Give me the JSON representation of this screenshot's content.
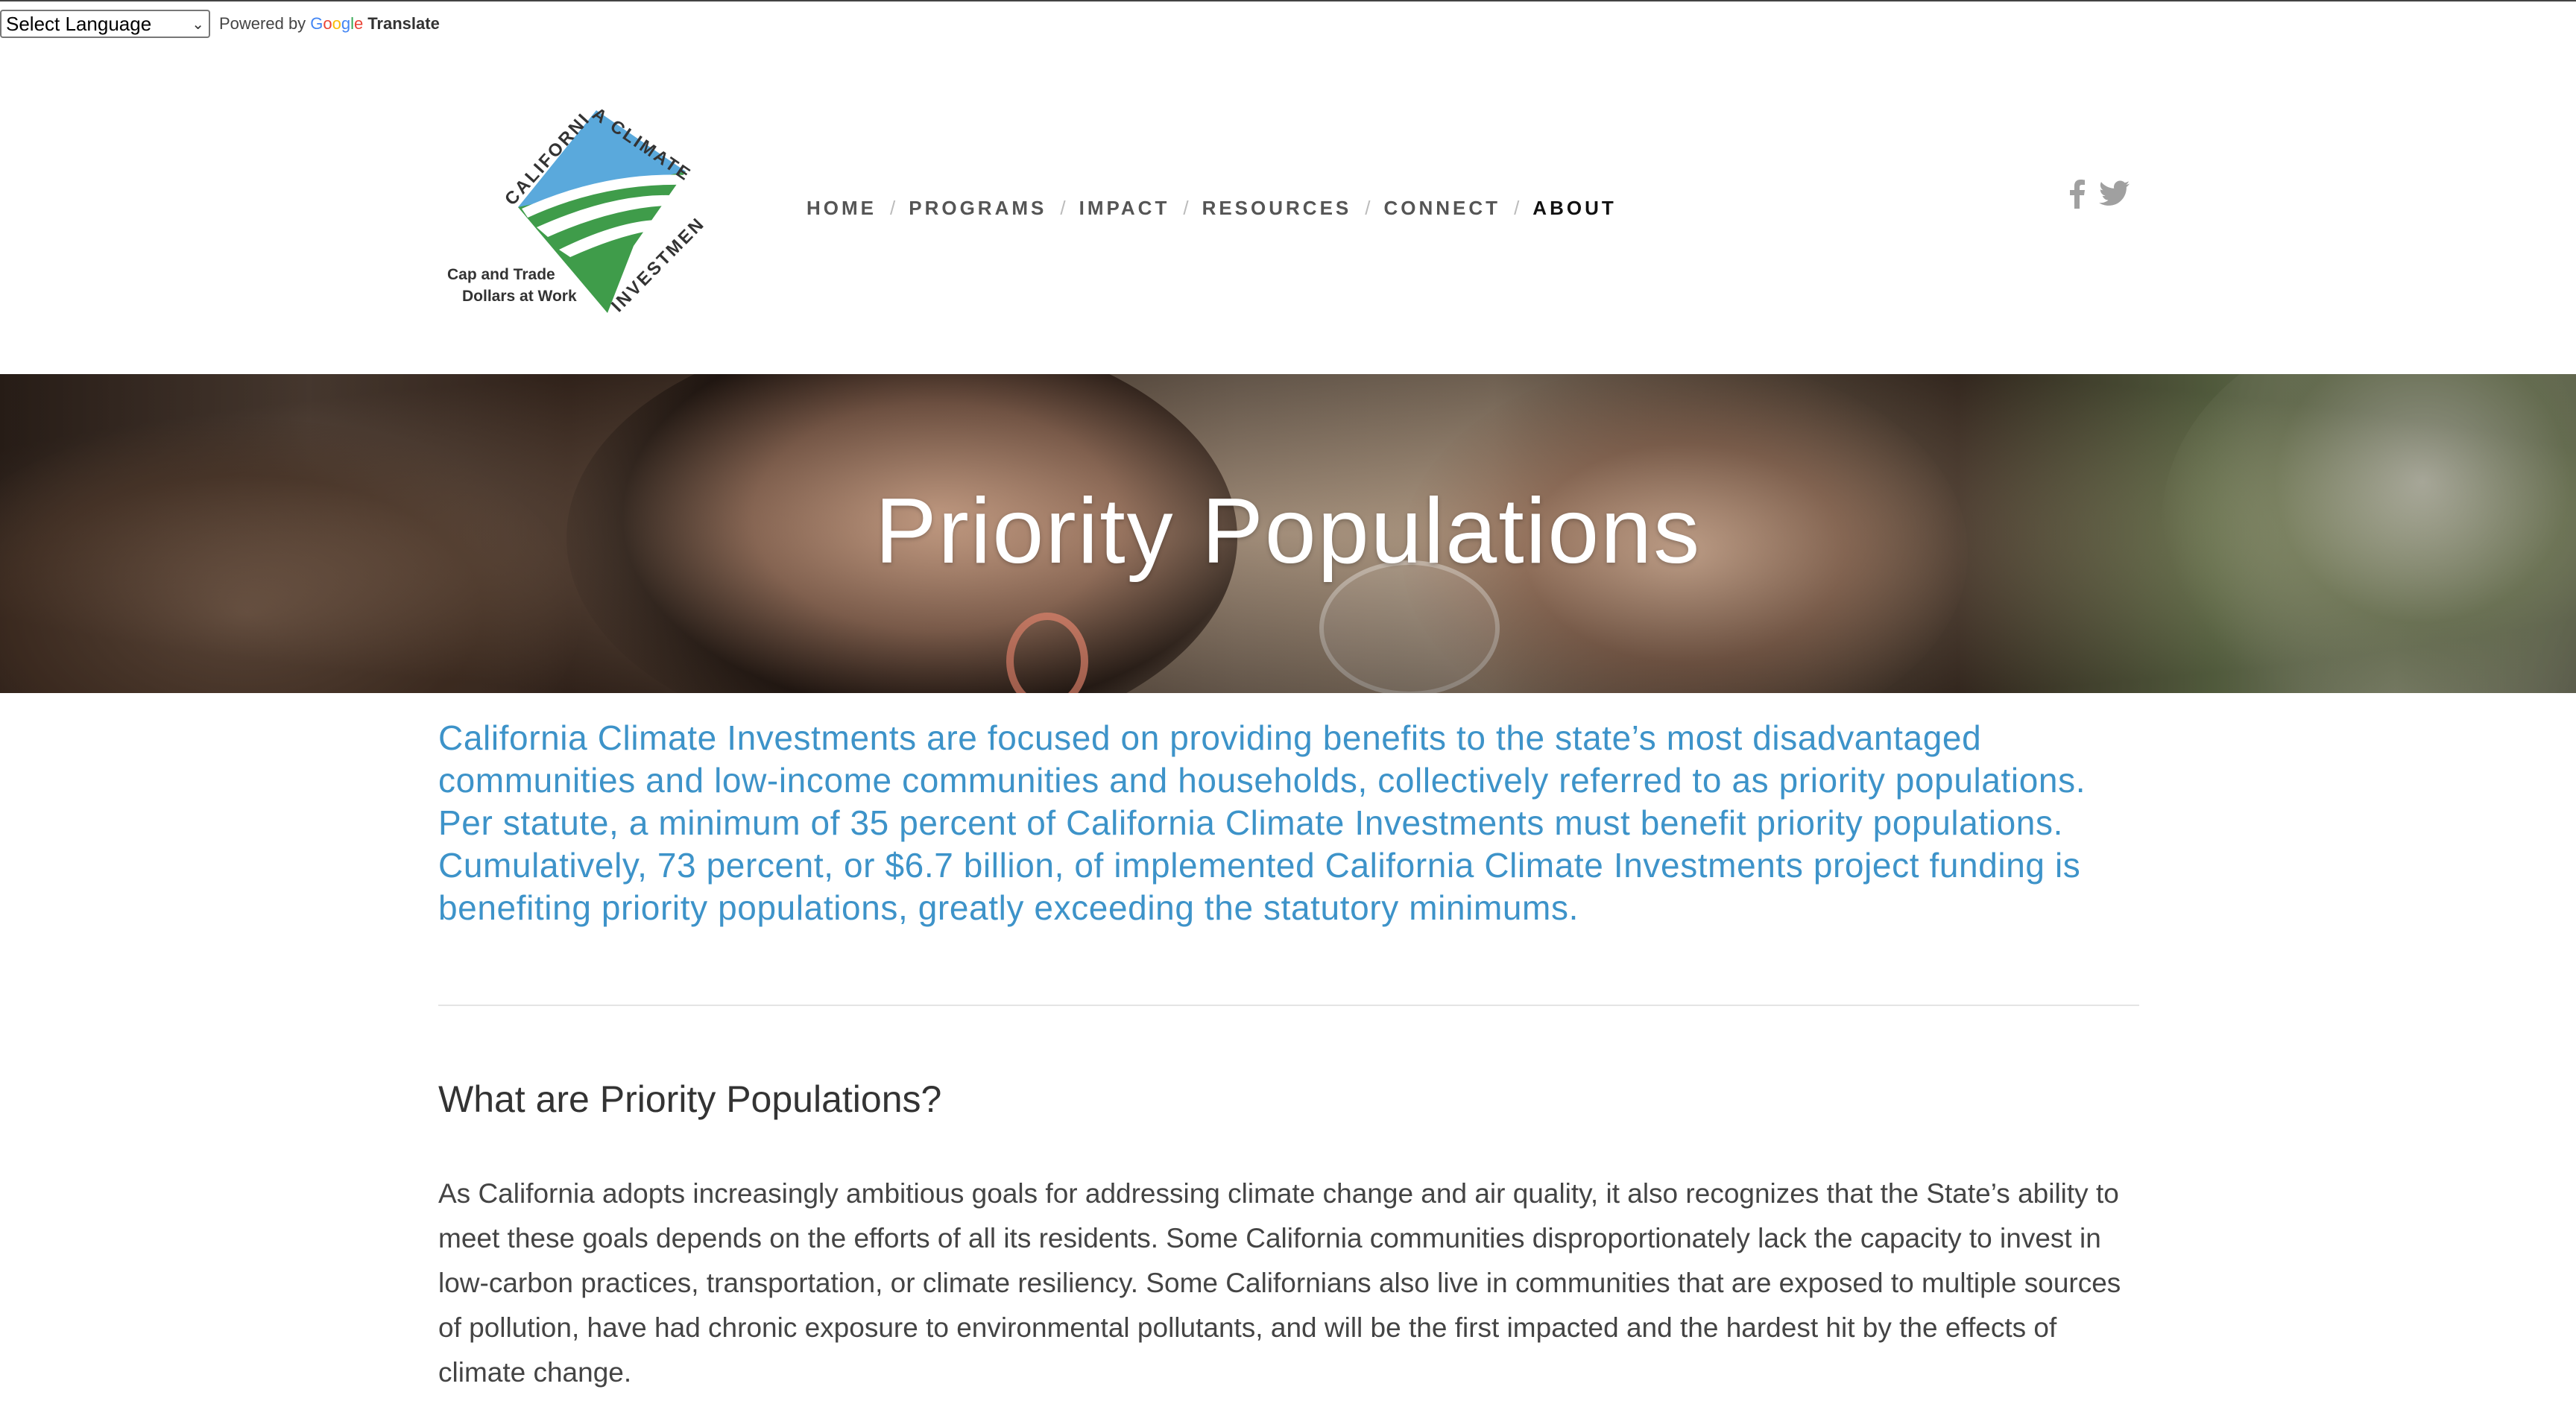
{
  "translate": {
    "select_label": "Select Language",
    "powered_by": "Powered by",
    "google": "Google",
    "translate_word": "Translate"
  },
  "logo": {
    "arc_top": "CALIFORNIA CLIMATE",
    "arc_bottom": "INVESTMENTS",
    "tagline_1": "Cap and Trade",
    "tagline_2": "Dollars at Work",
    "colors": {
      "blue": "#5aa9dc",
      "green": "#3f9c4a"
    }
  },
  "nav": {
    "items": [
      {
        "label": "HOME"
      },
      {
        "label": "PROGRAMS"
      },
      {
        "label": "IMPACT"
      },
      {
        "label": "RESOURCES"
      },
      {
        "label": "CONNECT"
      },
      {
        "label": "ABOUT",
        "active": true
      }
    ],
    "separator": "/"
  },
  "social": {
    "icons": [
      "facebook-icon",
      "twitter-icon"
    ],
    "color": "#a0a0a0"
  },
  "hero": {
    "title": "Priority Populations"
  },
  "intro": {
    "text": "California Climate Investments are focused on providing benefits to the state’s most disadvantaged communities and low-income communities and households, collectively referred to as priority populations. Per statute, a minimum of 35 percent of California Climate Investments must benefit priority populations. Cumulatively, 73 percent, or $6.7 billion, of implemented California Climate Investments project funding is benefiting priority populations, greatly exceeding the statutory minimums.",
    "color": "#3d93c9"
  },
  "section": {
    "heading": "What are Priority Populations?",
    "body": "As California adopts increasingly ambitious goals for addressing climate change and air quality, it also recognizes that the State’s ability to meet these goals depends on the efforts of all its residents. Some California communities disproportionately lack the capacity to invest in low-carbon practices, transportation, or climate resiliency. Some Californians also live in communities that are exposed to multiple sources of pollution, have had chronic exposure to environmental pollutants, and will be the first impacted and the hardest hit by the effects of climate change."
  }
}
